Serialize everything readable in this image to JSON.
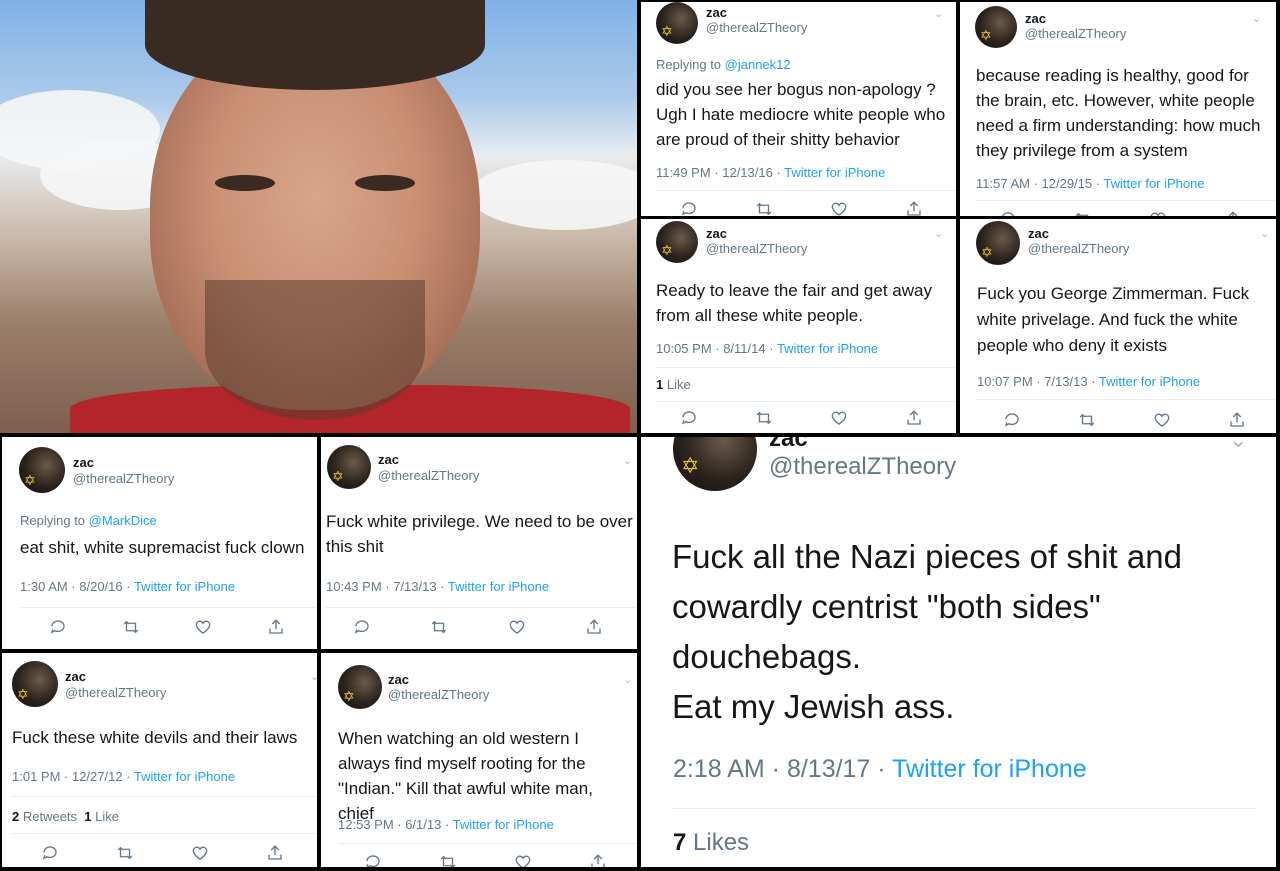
{
  "tweets": [
    {
      "name": "zac",
      "handle": "@therealZTheory",
      "reply_prefix": "Replying to ",
      "reply_to": "@jannek12",
      "text": "did you see her bogus non-apology ? Ugh I hate mediocre white people who are proud of their shitty behavior",
      "time": "11:49 PM · 12/13/16 · ",
      "source": "Twitter for iPhone"
    },
    {
      "name": "zac",
      "handle": "@therealZTheory",
      "text": "because reading is healthy, good for the brain, etc. However, white people need a firm understanding: how much they privilege from a system",
      "time": "11:57 AM · 12/29/15 · ",
      "source": "Twitter for iPhone"
    },
    {
      "name": "zac",
      "handle": "@therealZTheory",
      "text": "Ready to leave the fair and get away from all these white people.",
      "time": "10:05 PM · 8/11/14 · ",
      "source": "Twitter for iPhone",
      "likes_count": "1",
      "likes_label": " Like"
    },
    {
      "name": "zac",
      "handle": "@therealZTheory",
      "text": "Fuck you George Zimmerman. Fuck white privelage. And fuck the white people who deny it exists",
      "time": "10:07 PM · 7/13/13 · ",
      "source": "Twitter for iPhone"
    },
    {
      "name": "zac",
      "handle": "@therealZTheory",
      "reply_prefix": "Replying to ",
      "reply_to": "@MarkDice",
      "text": "eat shit, white supremacist fuck clown",
      "time": "1:30 AM · 8/20/16 · ",
      "source": "Twitter for iPhone"
    },
    {
      "name": "zac",
      "handle": "@therealZTheory",
      "text": "Fuck white privilege. We need to be over this shit",
      "time": "10:43 PM · 7/13/13 · ",
      "source": "Twitter for iPhone"
    },
    {
      "name": "zac",
      "handle": "@therealZTheory",
      "text": "Fuck all the Nazi pieces of shit and cowardly centrist \"both sides\" douchebags.\nEat my Jewish ass.",
      "time": "2:18 AM · 8/13/17 · ",
      "source": "Twitter for iPhone",
      "likes_count": "7",
      "likes_label": " Likes"
    },
    {
      "name": "zac",
      "handle": "@therealZTheory",
      "text": "Fuck these white devils and their laws",
      "time": "1:01 PM · 12/27/12 · ",
      "source": "Twitter for iPhone",
      "retweets_count": "2",
      "retweets_label": " Retweets  ",
      "likes_count": "1",
      "likes_label": " Like"
    },
    {
      "name": "zac",
      "handle": "@therealZTheory",
      "text": "When watching an old western I always find myself rooting for the \"Indian.\" Kill that awful white man, chief",
      "time": "12:53 PM · 6/1/13 · ",
      "source": "Twitter for iPhone"
    }
  ],
  "icons": [
    "reply-icon",
    "retweet-icon",
    "like-icon",
    "share-icon"
  ],
  "colors": {
    "link": "#1da1f2",
    "muted": "#657786",
    "text": "#14171a"
  }
}
